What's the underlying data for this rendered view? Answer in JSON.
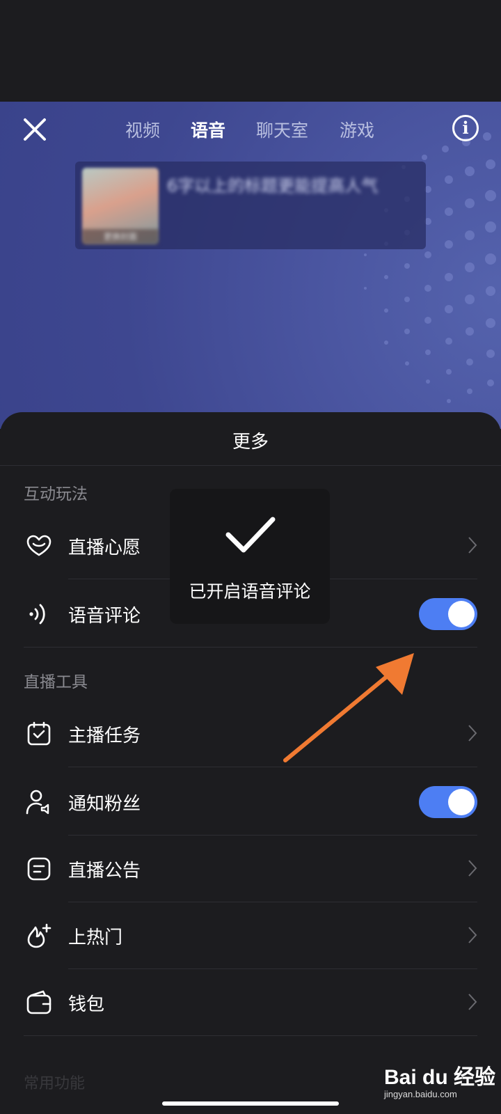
{
  "top_nav": {
    "tabs": [
      "视频",
      "语音",
      "聊天室",
      "游戏"
    ],
    "active_tab": "语音"
  },
  "cover": {
    "badge": "更换封面",
    "title": "6字以上的标题更能提高人气"
  },
  "sheet": {
    "title": "更多",
    "sections": [
      {
        "label": "互动玩法",
        "items": [
          {
            "label": "直播心愿",
            "icon": "heart-gift-icon",
            "control": "chevron"
          },
          {
            "label": "语音评论",
            "icon": "voice-waves-icon",
            "control": "toggle",
            "on": true
          }
        ]
      },
      {
        "label": "直播工具",
        "items": [
          {
            "label": "主播任务",
            "icon": "task-calendar-icon",
            "control": "chevron"
          },
          {
            "label": "通知粉丝",
            "icon": "user-notify-icon",
            "control": "toggle",
            "on": true
          },
          {
            "label": "直播公告",
            "icon": "announcement-icon",
            "control": "chevron"
          },
          {
            "label": "上热门",
            "icon": "flame-plus-icon",
            "control": "chevron"
          },
          {
            "label": "钱包",
            "icon": "wallet-icon",
            "control": "chevron"
          }
        ]
      }
    ],
    "next_section_partial": "常用功能"
  },
  "toast": {
    "message": "已开启语音评论",
    "icon": "checkmark-icon"
  },
  "watermark": {
    "brand": "Bai du 经验",
    "url": "jingyan.baidu.com"
  },
  "colors": {
    "toggle_on": "#4d7ef3",
    "sheet_bg": "#1c1c1f",
    "arrow": "#f07a32"
  }
}
